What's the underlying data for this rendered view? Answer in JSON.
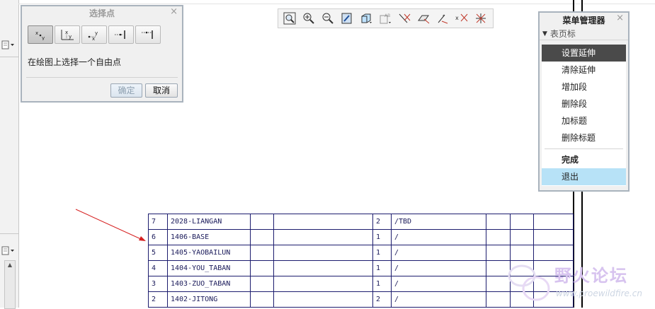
{
  "select_point_dialog": {
    "title": "选择点",
    "tools": [
      {
        "icon": "point-xy-icon",
        "active": true
      },
      {
        "icon": "point-absolute-coord-icon",
        "active": false
      },
      {
        "icon": "point-relative-coord-icon",
        "active": false
      },
      {
        "icon": "point-on-edge-icon",
        "active": false
      },
      {
        "icon": "point-on-vertex-icon",
        "active": false
      }
    ],
    "message": "在绘图上选择一个自由点",
    "ok_label": "确定",
    "cancel_label": "取消"
  },
  "toolbar": {
    "icons": [
      "zoom-fit-icon",
      "zoom-in-icon",
      "zoom-out-icon",
      "repaint-icon",
      "display-style-icon",
      "note-display-icon",
      "axis-display-icon",
      "plane-display-icon",
      "point-display-icon",
      "csys-display-icon",
      "spin-center-icon"
    ]
  },
  "menu_manager": {
    "title": "菜单管理器",
    "section": "表页标",
    "items": [
      {
        "label": "设置延伸",
        "state": "selected"
      },
      {
        "label": "清除延伸",
        "state": ""
      },
      {
        "label": "增加段",
        "state": ""
      },
      {
        "label": "删除段",
        "state": ""
      },
      {
        "label": "加标题",
        "state": ""
      },
      {
        "label": "删除标题",
        "state": ""
      }
    ],
    "done_label": "完成",
    "quit_label": "退出"
  },
  "bom_table": {
    "rows": [
      [
        "7",
        "2028-LIANGAN",
        "",
        "",
        "2",
        "/TBD",
        "",
        "",
        ""
      ],
      [
        "6",
        "1406-BASE",
        "",
        "",
        "1",
        "/",
        "",
        "",
        ""
      ],
      [
        "5",
        "1405-YAOBAILUN",
        "",
        "",
        "1",
        "/",
        "",
        "",
        ""
      ],
      [
        "4",
        "1404-YOU_TABAN",
        "",
        "",
        "1",
        "/",
        "",
        "",
        ""
      ],
      [
        "3",
        "1403-ZUO_TABAN",
        "",
        "",
        "1",
        "/",
        "",
        "",
        ""
      ],
      [
        "2",
        "1402-JITONG",
        "",
        "",
        "2",
        "/",
        "",
        "",
        ""
      ]
    ]
  },
  "colors": {
    "table_line": "#1c1c6e",
    "menu_selected": "#4a4a4a",
    "menu_hover": "#b7e2f7",
    "arrow": "#d62020"
  },
  "watermark": {
    "text": "野火论坛",
    "url": "www.proewildfire.cn"
  }
}
